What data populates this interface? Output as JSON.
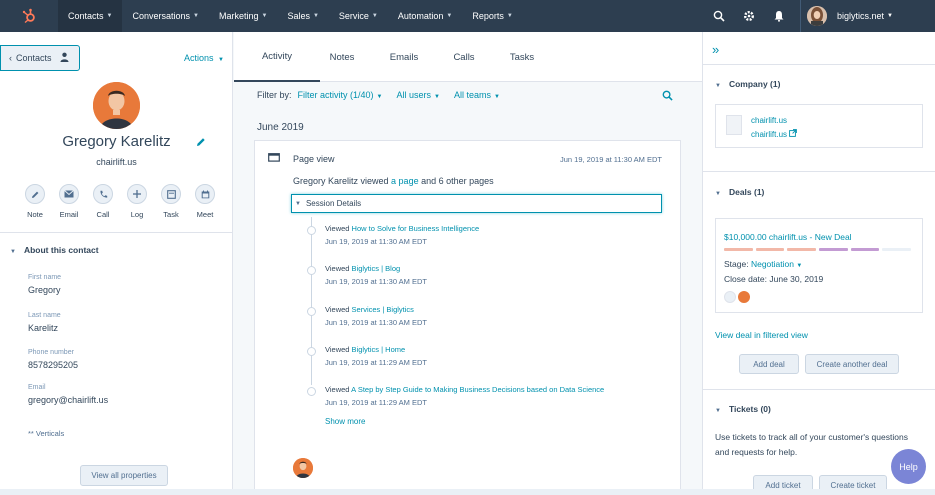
{
  "nav": {
    "items": [
      {
        "label": "Contacts",
        "active": true
      },
      {
        "label": "Conversations",
        "active": false
      },
      {
        "label": "Marketing",
        "active": false
      },
      {
        "label": "Sales",
        "active": false
      },
      {
        "label": "Service",
        "active": false
      },
      {
        "label": "Automation",
        "active": false
      },
      {
        "label": "Reports",
        "active": false
      }
    ],
    "account": "biglytics.net",
    "colors": {
      "bar": "#2d3e50",
      "logo": "#ff7a59"
    }
  },
  "left": {
    "back_label": "Contacts",
    "actions_label": "Actions",
    "contact_name": "Gregory Karelitz",
    "contact_domain": "chairlift.us",
    "quick_actions": [
      {
        "label": "Note",
        "icon": "note-icon"
      },
      {
        "label": "Email",
        "icon": "email-icon"
      },
      {
        "label": "Call",
        "icon": "phone-icon"
      },
      {
        "label": "Log",
        "icon": "plus-icon"
      },
      {
        "label": "Task",
        "icon": "task-icon"
      },
      {
        "label": "Meet",
        "icon": "calendar-icon"
      }
    ],
    "about_header": "About this contact",
    "properties": [
      {
        "label": "First name",
        "value": "Gregory"
      },
      {
        "label": "Last name",
        "value": "Karelitz"
      },
      {
        "label": "Phone number",
        "value": "8578295205"
      },
      {
        "label": "Email",
        "value": "gregory@chairlift.us"
      }
    ],
    "verticals": "** Verticals",
    "view_all": "View all properties"
  },
  "middle": {
    "tabs": [
      {
        "label": "Activity",
        "active": true
      },
      {
        "label": "Notes",
        "active": false
      },
      {
        "label": "Emails",
        "active": false
      },
      {
        "label": "Calls",
        "active": false
      },
      {
        "label": "Tasks",
        "active": false
      }
    ],
    "filter_label": "Filter by:",
    "filters": [
      "Filter activity (1/40)",
      "All users",
      "All teams"
    ],
    "month": "June 2019",
    "card": {
      "title": "Page view",
      "date": "Jun 19, 2019 at 11:30 AM EDT",
      "summary_pre": "Gregory Karelitz viewed ",
      "summary_link": "a page",
      "summary_post": " and 6 other pages",
      "session_label": "Session Details",
      "timeline": [
        {
          "prefix": "Viewed ",
          "link": "How to Solve for Business Intelligence",
          "time": "Jun 19, 2019 at 11:30 AM EDT"
        },
        {
          "prefix": "Viewed ",
          "link": "Biglytics | Blog",
          "time": "Jun 19, 2019 at 11:30 AM EDT"
        },
        {
          "prefix": "Viewed ",
          "link": "Services | Biglytics",
          "time": "Jun 19, 2019 at 11:30 AM EDT"
        },
        {
          "prefix": "Viewed ",
          "link": "Biglytics | Home",
          "time": "Jun 19, 2019 at 11:29 AM EDT"
        },
        {
          "prefix": "Viewed ",
          "link": "A Step by Step Guide to Making Business Decisions based on Data Science",
          "time": "Jun 19, 2019 at 11:29 AM EDT"
        }
      ],
      "show_more": "Show more"
    }
  },
  "right": {
    "company_header": "Company (1)",
    "company_name": "chairlift.us",
    "company_domain": "chairlift.us",
    "deals_header": "Deals (1)",
    "deal": {
      "name": "$10,000.00 chairlift.us - New Deal",
      "stage_label": "Stage:",
      "stage_value": "Negotiation",
      "close_label": "Close date:",
      "close_value": "June 30, 2019",
      "stage_colors": [
        "#f2b8a8",
        "#f2b8a8",
        "#f2b8a8",
        "#c39bd3",
        "#c39bd3",
        "#eaf0f6"
      ]
    },
    "view_deal": "View deal in filtered view",
    "add_deal": "Add deal",
    "create_deal": "Create another deal",
    "tickets_header": "Tickets (0)",
    "tickets_text": "Use tickets to track all of your customer's questions and requests for help.",
    "add_ticket": "Add ticket",
    "create_ticket": "Create ticket"
  },
  "help_label": "Help"
}
